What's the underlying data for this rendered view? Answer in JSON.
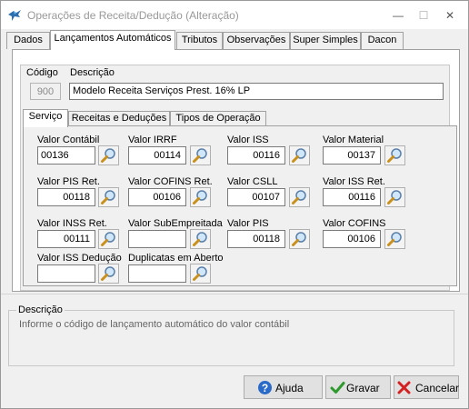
{
  "window": {
    "title": "Operações de Receita/Dedução (Alteração)",
    "minimize_glyph": "—",
    "maximize_glyph": "☐",
    "close_glyph": "✕"
  },
  "tabs": [
    {
      "label": "Dados",
      "active": false
    },
    {
      "label": "Lançamentos Automáticos",
      "active": true
    },
    {
      "label": "Tributos",
      "active": false
    },
    {
      "label": "Observações",
      "active": false
    },
    {
      "label": "Super Simples",
      "active": false
    },
    {
      "label": "Dacon",
      "active": false
    }
  ],
  "header": {
    "codigo_label": "Código",
    "codigo_value": "900",
    "descricao_label": "Descrição",
    "descricao_value": "Modelo Receita Serviços Prest. 16% LP"
  },
  "inner_tabs": [
    {
      "label": "Serviço",
      "active": true
    },
    {
      "label": "Receitas e Deduções",
      "active": false
    },
    {
      "label": "Tipos de Operação",
      "active": false
    }
  ],
  "fields": [
    {
      "label": "Valor Contábil",
      "value": "00136",
      "align": "left"
    },
    {
      "label": "Valor IRRF",
      "value": "00114"
    },
    {
      "label": "Valor ISS",
      "value": "00116"
    },
    {
      "label": "Valor Material",
      "value": "00137"
    },
    {
      "label": "Valor PIS Ret.",
      "value": "00118"
    },
    {
      "label": "Valor COFINS Ret.",
      "value": "00106"
    },
    {
      "label": "Valor CSLL",
      "value": "00107"
    },
    {
      "label": "Valor ISS Ret.",
      "value": "00116"
    },
    {
      "label": "Valor INSS Ret.",
      "value": "00111"
    },
    {
      "label": "Valor SubEmpreitada",
      "value": ""
    },
    {
      "label": "Valor PIS",
      "value": "00118"
    },
    {
      "label": "Valor COFINS",
      "value": "00106"
    },
    {
      "label": "Valor ISS Dedução",
      "value": ""
    },
    {
      "label": "Duplicatas em Aberto",
      "value": ""
    }
  ],
  "description": {
    "legend": "Descrição",
    "text": "Informe o código de lançamento automático do valor contábil"
  },
  "buttons": {
    "help": {
      "label": "Ajuda",
      "icon": "help-icon"
    },
    "save": {
      "label": "Gravar",
      "icon": "check-icon"
    },
    "cancel": {
      "label": "Cancelar",
      "icon": "x-icon"
    }
  },
  "colors": {
    "help_icon": "#2a6ac9",
    "save_icon": "#2e9a2e",
    "cancel_icon": "#d42020",
    "title_text": "#999999"
  }
}
